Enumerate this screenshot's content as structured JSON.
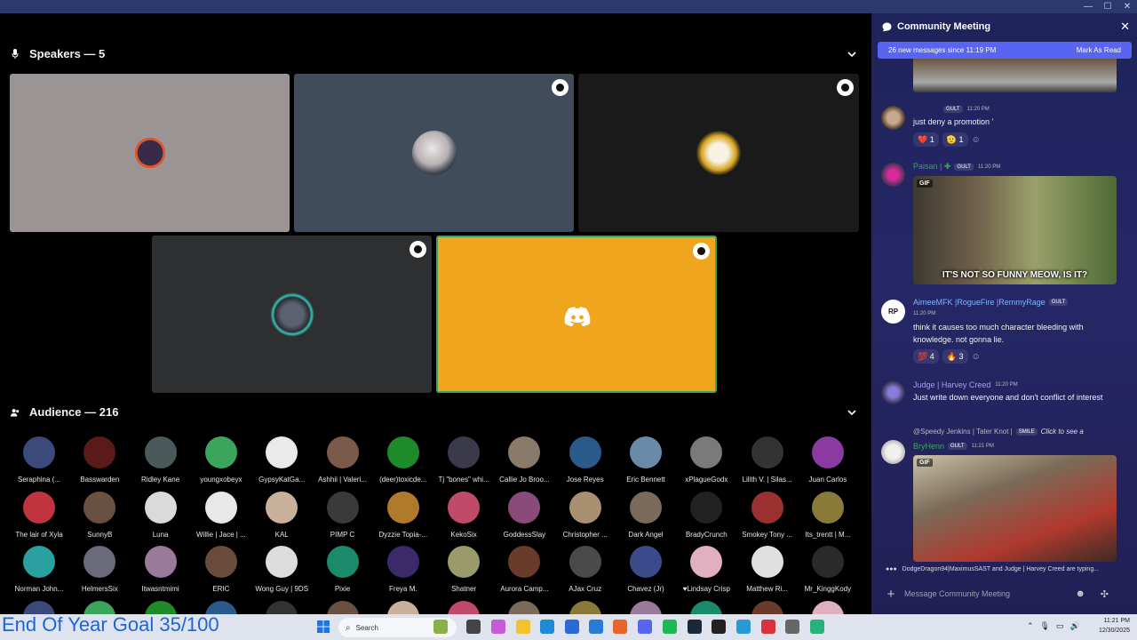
{
  "window": {
    "minimize": "—",
    "maximize": "☐",
    "close": "✕"
  },
  "speakers": {
    "header": "Speakers — 5"
  },
  "audience": {
    "header": "Audience — 216",
    "rows": [
      [
        "Seraphina (...",
        "Basswarden",
        "Ridley Kane",
        "youngxobeyx",
        "GypsyKatGa...",
        "Ashhii | Valeri...",
        "(deer)toxicde...",
        "Tj \"bones\" whi...",
        "Callie Jo Broo...",
        "Jose Reyes",
        "Eric Bennett",
        "xPlagueGodx",
        "Lilith V. | Silas...",
        "Juan Carlos"
      ],
      [
        "The lair of Xyla",
        "SunnyB",
        "Luna",
        "Willie | Jace | ...",
        "KAL",
        "PIMP C",
        "Dyzzie Topia-...",
        "KekoSix",
        "GoddessSlay",
        "Christopher ...",
        "Dark Angel",
        "BradyCrunch",
        "Smokey Tony ...",
        "Its_trentt | M..."
      ],
      [
        "Norman John...",
        "HelmersSix",
        "Itwasntmimi",
        "ERIC",
        "Wong Guy | 9DS",
        "Pixie",
        "Freya M.",
        "Shatner",
        "Aurora Camp...",
        "AJax Cruz",
        "Chavez (Jr)",
        "♥Lindsay Crisp",
        "Matthew Ri...",
        "Mr_KinggKody"
      ]
    ]
  },
  "chat": {
    "title": "Community Meeting",
    "new_messages": "26 new messages since 11:19 PM",
    "mark_read": "Mark As Read",
    "messages": [
      {
        "author": "",
        "tag": "GULT",
        "time": "11:20 PM",
        "text": "just deny a promotion '",
        "reactions": [
          {
            "emoji": "❤️",
            "count": "1"
          },
          {
            "emoji": "🫡",
            "count": "1"
          }
        ]
      },
      {
        "author": "Paisan | ✚",
        "tag": "GULT",
        "time": "11:20 PM",
        "gif_label": "GIF",
        "caption": "IT'S NOT SO FUNNY MEOW, IS IT?"
      },
      {
        "author": "AimeeMFK |RogueFire |RemmyRage",
        "tag": "GULT",
        "time": "11:20 PM",
        "avatar_text": "RP",
        "text": "think it causes too much character bleeding with knowledge. not gonna lie.",
        "reactions": [
          {
            "emoji": "💯",
            "count": "4"
          },
          {
            "emoji": "🔥",
            "count": "3"
          }
        ]
      },
      {
        "author": "Judge | Harvey Creed",
        "time": "11:20 PM",
        "text": "Just write down everyone and don't conflict of interest"
      },
      {
        "reply": "@Speedy Jenkins | Tater Knot |",
        "reply_tag": "SMILE",
        "reply_hint": "Click to see a",
        "author": "BryHenn",
        "tag": "GULT",
        "time": "11:21 PM",
        "gif_label": "GIF"
      }
    ],
    "typing": "DodgeDragon94|MaximusSAST and Judge | Harvey Creed are typing...",
    "placeholder": "Message Community Meeting"
  },
  "taskbar": {
    "overlay": "End Of Year Goal 35/100",
    "search": "Search",
    "time": "11:21 PM",
    "date": "12/30/2025"
  },
  "colors": {
    "accent": "#5865f2",
    "speaking_tile": "#f0a51e",
    "name_purple": "#9b7bff",
    "name_green": "#3ba55c",
    "name_blue": "#7db7ff"
  }
}
